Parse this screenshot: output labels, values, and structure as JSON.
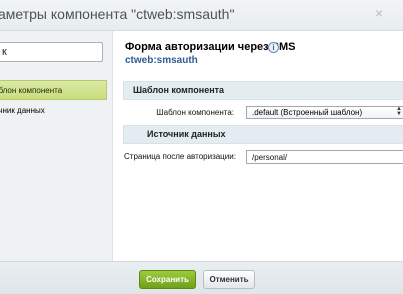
{
  "dialog": {
    "title": "аметры компонента \"ctweb:smsauth\"",
    "close_glyph": "×"
  },
  "sidebar": {
    "search_value": "к",
    "items": [
      {
        "label": "аблон компонента",
        "active": true
      },
      {
        "label": "очник данных",
        "active": false
      }
    ]
  },
  "content": {
    "heading": "Форма авторизации через SMS",
    "info_glyph": "i",
    "component_code": "ctweb:smsauth",
    "sections": [
      {
        "title": "Шаблон компонента"
      },
      {
        "title": "Источник данных"
      }
    ],
    "template_row": {
      "label": "Шаблон компонента:",
      "selected": ".default (Встроенный шаблон)"
    },
    "redirect_row": {
      "label": "Страница после авторизации:",
      "value": "/personal/"
    }
  },
  "footer": {
    "save_label": "Сохранить",
    "cancel_label": "Отменить"
  },
  "colors": {
    "accent_green": "#6f9f1c",
    "active_item": "#c8de7c",
    "section_bg": "#e3ecf0",
    "link_blue": "#2d5c8e"
  }
}
